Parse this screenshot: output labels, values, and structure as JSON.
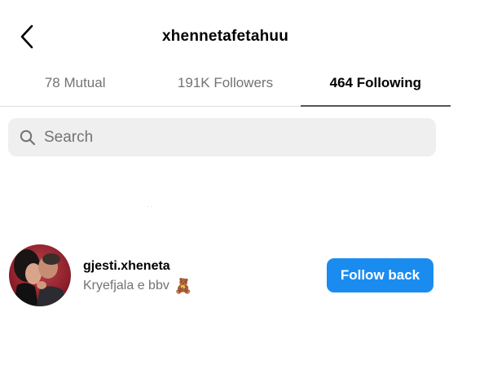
{
  "header": {
    "title": "xhennetafetahuu",
    "back_icon": "chevron-left-icon"
  },
  "tabs": [
    {
      "label": "78 Mutual",
      "active": false
    },
    {
      "label": "191K Followers",
      "active": false
    },
    {
      "label": "464 Following",
      "active": true
    }
  ],
  "search": {
    "placeholder": "Search",
    "value": "",
    "icon": "search-icon"
  },
  "list": [
    {
      "username": "gjesti.xheneta",
      "full_name": "Kryefjala e bbv",
      "emoji": "🧸",
      "button_label": "Follow back"
    }
  ],
  "colors": {
    "button_blue": "#1a8cf0",
    "tab_inactive": "#737373",
    "search_bg": "#efefef"
  }
}
